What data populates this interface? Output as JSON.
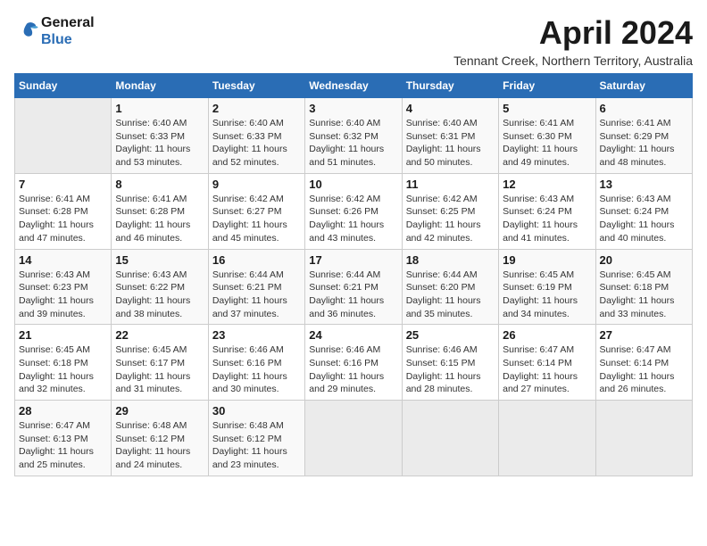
{
  "logo": {
    "line1": "General",
    "line2": "Blue"
  },
  "title": "April 2024",
  "subtitle": "Tennant Creek, Northern Territory, Australia",
  "weekdays": [
    "Sunday",
    "Monday",
    "Tuesday",
    "Wednesday",
    "Thursday",
    "Friday",
    "Saturday"
  ],
  "weeks": [
    [
      {
        "day": "",
        "sunrise": "",
        "sunset": "",
        "daylight": ""
      },
      {
        "day": "1",
        "sunrise": "Sunrise: 6:40 AM",
        "sunset": "Sunset: 6:33 PM",
        "daylight": "Daylight: 11 hours and 53 minutes."
      },
      {
        "day": "2",
        "sunrise": "Sunrise: 6:40 AM",
        "sunset": "Sunset: 6:33 PM",
        "daylight": "Daylight: 11 hours and 52 minutes."
      },
      {
        "day": "3",
        "sunrise": "Sunrise: 6:40 AM",
        "sunset": "Sunset: 6:32 PM",
        "daylight": "Daylight: 11 hours and 51 minutes."
      },
      {
        "day": "4",
        "sunrise": "Sunrise: 6:40 AM",
        "sunset": "Sunset: 6:31 PM",
        "daylight": "Daylight: 11 hours and 50 minutes."
      },
      {
        "day": "5",
        "sunrise": "Sunrise: 6:41 AM",
        "sunset": "Sunset: 6:30 PM",
        "daylight": "Daylight: 11 hours and 49 minutes."
      },
      {
        "day": "6",
        "sunrise": "Sunrise: 6:41 AM",
        "sunset": "Sunset: 6:29 PM",
        "daylight": "Daylight: 11 hours and 48 minutes."
      }
    ],
    [
      {
        "day": "7",
        "sunrise": "Sunrise: 6:41 AM",
        "sunset": "Sunset: 6:28 PM",
        "daylight": "Daylight: 11 hours and 47 minutes."
      },
      {
        "day": "8",
        "sunrise": "Sunrise: 6:41 AM",
        "sunset": "Sunset: 6:28 PM",
        "daylight": "Daylight: 11 hours and 46 minutes."
      },
      {
        "day": "9",
        "sunrise": "Sunrise: 6:42 AM",
        "sunset": "Sunset: 6:27 PM",
        "daylight": "Daylight: 11 hours and 45 minutes."
      },
      {
        "day": "10",
        "sunrise": "Sunrise: 6:42 AM",
        "sunset": "Sunset: 6:26 PM",
        "daylight": "Daylight: 11 hours and 43 minutes."
      },
      {
        "day": "11",
        "sunrise": "Sunrise: 6:42 AM",
        "sunset": "Sunset: 6:25 PM",
        "daylight": "Daylight: 11 hours and 42 minutes."
      },
      {
        "day": "12",
        "sunrise": "Sunrise: 6:43 AM",
        "sunset": "Sunset: 6:24 PM",
        "daylight": "Daylight: 11 hours and 41 minutes."
      },
      {
        "day": "13",
        "sunrise": "Sunrise: 6:43 AM",
        "sunset": "Sunset: 6:24 PM",
        "daylight": "Daylight: 11 hours and 40 minutes."
      }
    ],
    [
      {
        "day": "14",
        "sunrise": "Sunrise: 6:43 AM",
        "sunset": "Sunset: 6:23 PM",
        "daylight": "Daylight: 11 hours and 39 minutes."
      },
      {
        "day": "15",
        "sunrise": "Sunrise: 6:43 AM",
        "sunset": "Sunset: 6:22 PM",
        "daylight": "Daylight: 11 hours and 38 minutes."
      },
      {
        "day": "16",
        "sunrise": "Sunrise: 6:44 AM",
        "sunset": "Sunset: 6:21 PM",
        "daylight": "Daylight: 11 hours and 37 minutes."
      },
      {
        "day": "17",
        "sunrise": "Sunrise: 6:44 AM",
        "sunset": "Sunset: 6:21 PM",
        "daylight": "Daylight: 11 hours and 36 minutes."
      },
      {
        "day": "18",
        "sunrise": "Sunrise: 6:44 AM",
        "sunset": "Sunset: 6:20 PM",
        "daylight": "Daylight: 11 hours and 35 minutes."
      },
      {
        "day": "19",
        "sunrise": "Sunrise: 6:45 AM",
        "sunset": "Sunset: 6:19 PM",
        "daylight": "Daylight: 11 hours and 34 minutes."
      },
      {
        "day": "20",
        "sunrise": "Sunrise: 6:45 AM",
        "sunset": "Sunset: 6:18 PM",
        "daylight": "Daylight: 11 hours and 33 minutes."
      }
    ],
    [
      {
        "day": "21",
        "sunrise": "Sunrise: 6:45 AM",
        "sunset": "Sunset: 6:18 PM",
        "daylight": "Daylight: 11 hours and 32 minutes."
      },
      {
        "day": "22",
        "sunrise": "Sunrise: 6:45 AM",
        "sunset": "Sunset: 6:17 PM",
        "daylight": "Daylight: 11 hours and 31 minutes."
      },
      {
        "day": "23",
        "sunrise": "Sunrise: 6:46 AM",
        "sunset": "Sunset: 6:16 PM",
        "daylight": "Daylight: 11 hours and 30 minutes."
      },
      {
        "day": "24",
        "sunrise": "Sunrise: 6:46 AM",
        "sunset": "Sunset: 6:16 PM",
        "daylight": "Daylight: 11 hours and 29 minutes."
      },
      {
        "day": "25",
        "sunrise": "Sunrise: 6:46 AM",
        "sunset": "Sunset: 6:15 PM",
        "daylight": "Daylight: 11 hours and 28 minutes."
      },
      {
        "day": "26",
        "sunrise": "Sunrise: 6:47 AM",
        "sunset": "Sunset: 6:14 PM",
        "daylight": "Daylight: 11 hours and 27 minutes."
      },
      {
        "day": "27",
        "sunrise": "Sunrise: 6:47 AM",
        "sunset": "Sunset: 6:14 PM",
        "daylight": "Daylight: 11 hours and 26 minutes."
      }
    ],
    [
      {
        "day": "28",
        "sunrise": "Sunrise: 6:47 AM",
        "sunset": "Sunset: 6:13 PM",
        "daylight": "Daylight: 11 hours and 25 minutes."
      },
      {
        "day": "29",
        "sunrise": "Sunrise: 6:48 AM",
        "sunset": "Sunset: 6:12 PM",
        "daylight": "Daylight: 11 hours and 24 minutes."
      },
      {
        "day": "30",
        "sunrise": "Sunrise: 6:48 AM",
        "sunset": "Sunset: 6:12 PM",
        "daylight": "Daylight: 11 hours and 23 minutes."
      },
      {
        "day": "",
        "sunrise": "",
        "sunset": "",
        "daylight": ""
      },
      {
        "day": "",
        "sunrise": "",
        "sunset": "",
        "daylight": ""
      },
      {
        "day": "",
        "sunrise": "",
        "sunset": "",
        "daylight": ""
      },
      {
        "day": "",
        "sunrise": "",
        "sunset": "",
        "daylight": ""
      }
    ]
  ]
}
